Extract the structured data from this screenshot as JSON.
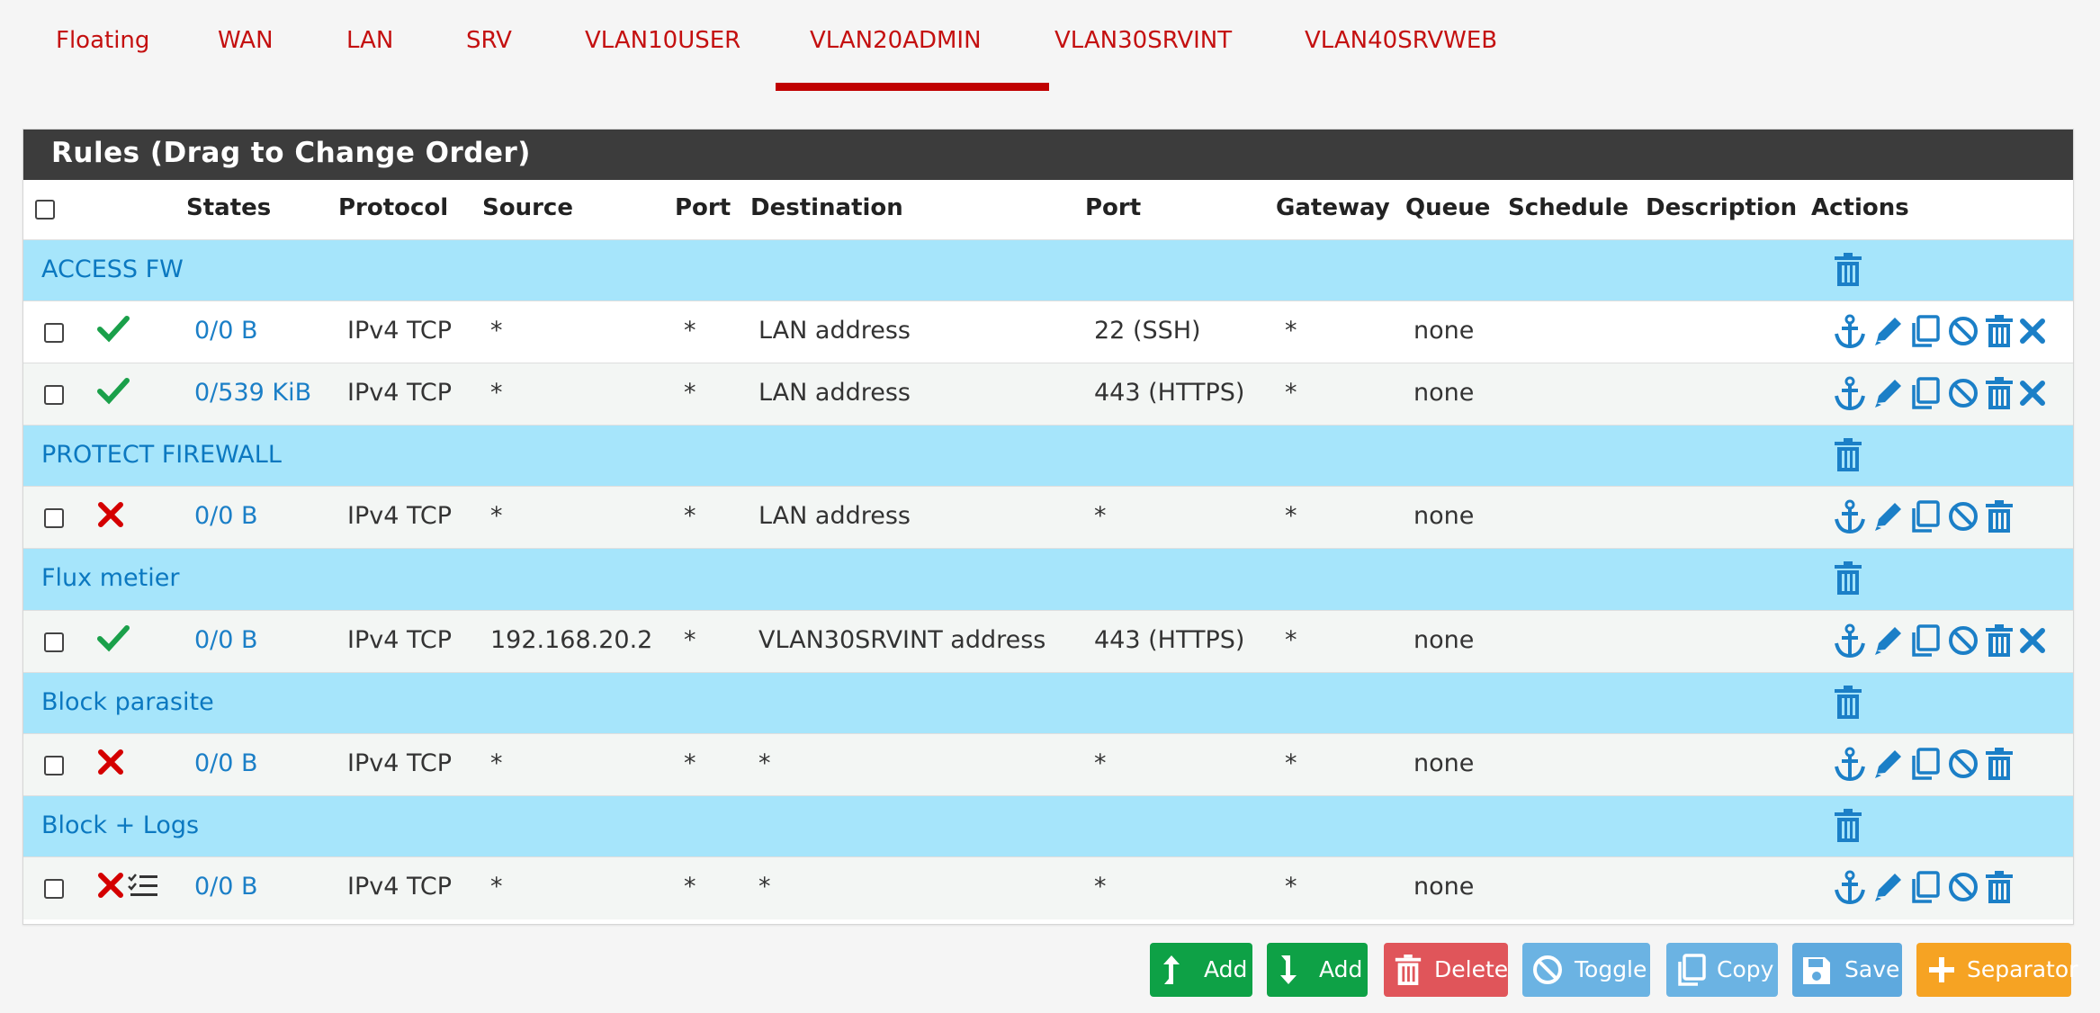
{
  "tabs": [
    {
      "label": "Floating"
    },
    {
      "label": "WAN"
    },
    {
      "label": "LAN"
    },
    {
      "label": "SRV"
    },
    {
      "label": "VLAN10USER"
    },
    {
      "label": "VLAN20ADMIN",
      "active": true
    },
    {
      "label": "VLAN30SRVINT"
    },
    {
      "label": "VLAN40SRVWEB"
    }
  ],
  "panel": {
    "title": "Rules (Drag to Change Order)",
    "columns": {
      "states": "States",
      "protocol": "Protocol",
      "source": "Source",
      "port": "Port",
      "destination": "Destination",
      "dport": "Port",
      "gateway": "Gateway",
      "queue": "Queue",
      "schedule": "Schedule",
      "description": "Description",
      "actions": "Actions"
    }
  },
  "separators": [
    {
      "label": "ACCESS FW"
    },
    {
      "label": "PROTECT FIREWALL"
    },
    {
      "label": "Flux metier"
    },
    {
      "label": "Block parasite"
    },
    {
      "label": "Block + Logs"
    }
  ],
  "rules": [
    {
      "status": "pass",
      "states": "0/0 B",
      "protocol": "IPv4 TCP",
      "source": "*",
      "port": "*",
      "destination": "LAN address",
      "dport": "22 (SSH)",
      "gateway": "*",
      "queue": "none",
      "schedule": "",
      "description": ""
    },
    {
      "status": "pass",
      "states": "0/539 KiB",
      "protocol": "IPv4 TCP",
      "source": "*",
      "port": "*",
      "destination": "LAN address",
      "dport": "443 (HTTPS)",
      "gateway": "*",
      "queue": "none",
      "schedule": "",
      "description": ""
    },
    {
      "status": "block",
      "states": "0/0 B",
      "protocol": "IPv4 TCP",
      "source": "*",
      "port": "*",
      "destination": "LAN address",
      "dport": "*",
      "gateway": "*",
      "queue": "none",
      "schedule": "",
      "description": ""
    },
    {
      "status": "pass",
      "states": "0/0 B",
      "protocol": "IPv4 TCP",
      "source": "192.168.20.2",
      "port": "*",
      "destination": "VLAN30SRVINT address",
      "dport": "443 (HTTPS)",
      "gateway": "*",
      "queue": "none",
      "schedule": "",
      "description": ""
    },
    {
      "status": "block",
      "states": "0/0 B",
      "protocol": "IPv4 TCP",
      "source": "*",
      "port": "*",
      "destination": "*",
      "dport": "*",
      "gateway": "*",
      "queue": "none",
      "schedule": "",
      "description": ""
    },
    {
      "status": "block-log",
      "states": "0/0 B",
      "protocol": "IPv4 TCP",
      "source": "*",
      "port": "*",
      "destination": "*",
      "dport": "*",
      "gateway": "*",
      "queue": "none",
      "schedule": "",
      "description": ""
    }
  ],
  "buttons": {
    "add_top": "Add",
    "add_bottom": "Add",
    "delete": "Delete",
    "toggle": "Toggle",
    "copy": "Copy",
    "save": "Save",
    "separator": "Separator"
  },
  "colors": {
    "accent": "#c00000",
    "link": "#1b7fc7",
    "separator_bg": "#a6e5fb",
    "pass": "#1aa04a",
    "block": "#d40000",
    "btn_add": "#0ea146",
    "btn_delete": "#e0555a",
    "btn_toggle": "#6bb3e3",
    "btn_save": "#5ea9de",
    "btn_separator": "#f6a323"
  }
}
